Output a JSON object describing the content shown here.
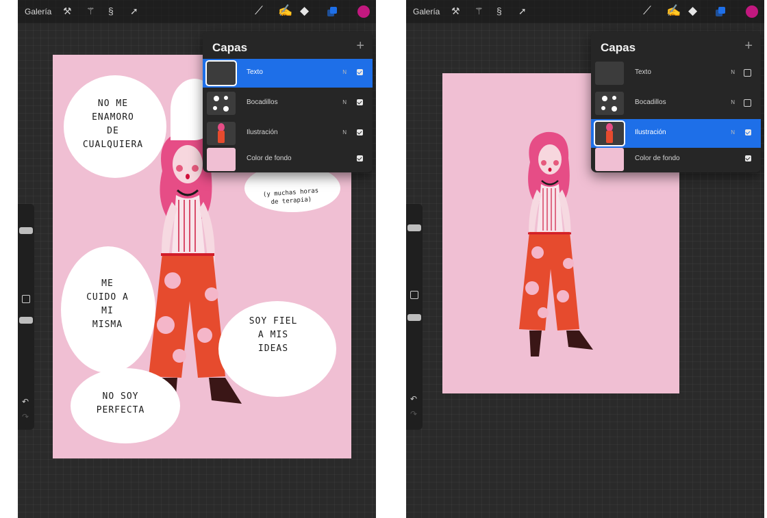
{
  "left": {
    "toolbar": {
      "gallery": "Galería",
      "tools": [
        "wrench-icon",
        "magic-wand-icon",
        "selection-icon",
        "transform-icon"
      ],
      "right_tools": [
        "brush-icon",
        "smudge-icon",
        "eraser-icon",
        "layers-icon",
        "color-icon"
      ]
    },
    "layers_panel": {
      "title": "Capas",
      "add": "+",
      "layers": [
        {
          "name": "Texto",
          "blend": "N",
          "visible": true,
          "selected": true
        },
        {
          "name": "Bocadillos",
          "blend": "N",
          "visible": true,
          "selected": false
        },
        {
          "name": "Ilustración",
          "blend": "N",
          "visible": true,
          "selected": false
        },
        {
          "name": "Color de fondo",
          "blend": "",
          "visible": true,
          "selected": false
        }
      ]
    },
    "speech_bubbles": [
      "NO ME\nENAMORO\nDE\nCUALQUIERA",
      "ME\nCUIDO A\nMI\nMISMA",
      "SOY FIEL\nA MIS\nIDEAS",
      "NO SOY\nPERFECTA"
    ],
    "side_note": "(y muchas horas\nde terapia)"
  },
  "right": {
    "toolbar": {
      "gallery": "Galería"
    },
    "layers_panel": {
      "title": "Capas",
      "add": "+",
      "layers": [
        {
          "name": "Texto",
          "blend": "N",
          "visible": false,
          "selected": false
        },
        {
          "name": "Bocadillos",
          "blend": "N",
          "visible": false,
          "selected": false
        },
        {
          "name": "Ilustración",
          "blend": "N",
          "visible": true,
          "selected": true
        },
        {
          "name": "Color de fondo",
          "blend": "",
          "visible": true,
          "selected": false
        }
      ]
    }
  },
  "colors": {
    "canvas_pink": "#f0bfd3",
    "accent_blue": "#1e6fe8",
    "active_color": "#c2187f",
    "hair_pink": "#e64d86",
    "pants_red": "#e64b2e"
  }
}
